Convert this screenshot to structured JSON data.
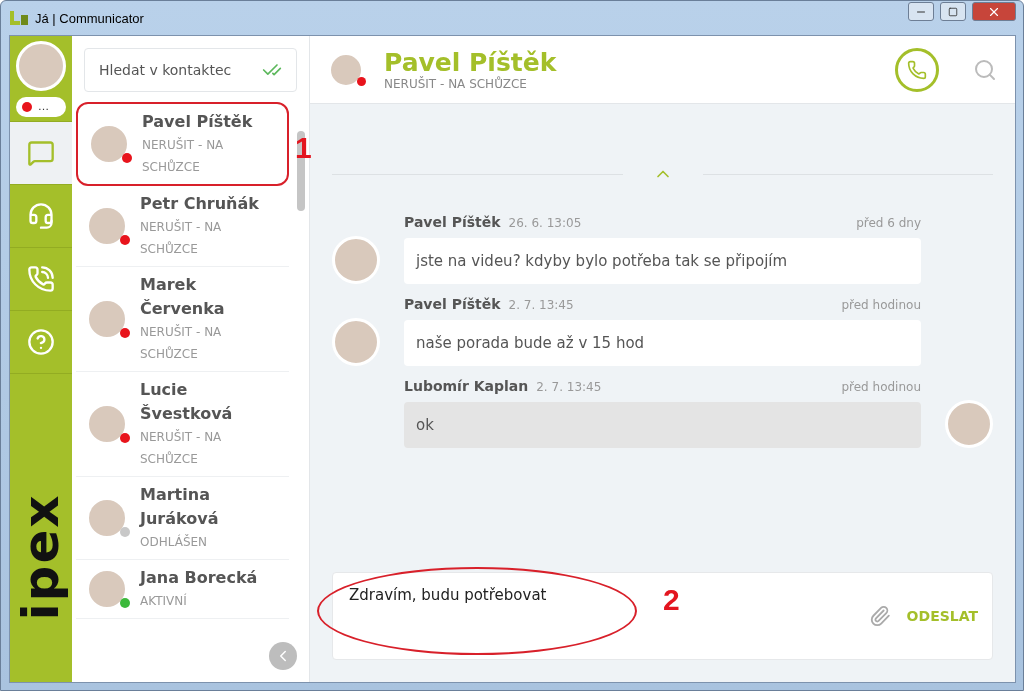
{
  "window": {
    "title": "Já | Communicator"
  },
  "me": {
    "busy": true,
    "status_text": "…"
  },
  "rail": [
    {
      "kind": "chat",
      "selected": true
    },
    {
      "kind": "headset",
      "selected": false
    },
    {
      "kind": "calls",
      "selected": false
    },
    {
      "kind": "help",
      "selected": false
    }
  ],
  "logo": "ipex",
  "search": {
    "placeholder": "Hledat v kontaktec"
  },
  "contacts": [
    {
      "name": "Pavel Píštěk",
      "status": "NERUŠIT - NA SCHŮZCE",
      "color": "#e8141c",
      "selected": true
    },
    {
      "name": "Petr Chruňák",
      "status": "NERUŠIT - NA SCHŮZCE",
      "color": "#e8141c",
      "selected": false
    },
    {
      "name": "Marek Červenka",
      "status": "NERUŠIT - NA SCHŮZCE",
      "color": "#e8141c",
      "selected": false
    },
    {
      "name": "Lucie Švestková",
      "status": "NERUŠIT - NA SCHŮZCE",
      "color": "#e8141c",
      "selected": false
    },
    {
      "name": "Martina Juráková",
      "status": "ODHLÁŠEN",
      "color": "#c8c8c8",
      "selected": false
    },
    {
      "name": "Jana Borecká",
      "status": "AKTIVNÍ",
      "color": "#3cb93c",
      "selected": false
    }
  ],
  "chat": {
    "name": "Pavel Píštěk",
    "status": "NERUŠIT - NA SCHŮZCE",
    "busy": true
  },
  "messages": [
    {
      "author": "Pavel Píštěk",
      "date": "26. 6. 13:05",
      "ago": "před 6 dny",
      "text": "jste na videu? kdyby bylo potřeba tak se připojím",
      "kind": "incoming"
    },
    {
      "author": "Pavel Píštěk",
      "date": "2. 7. 13:45",
      "ago": "před hodinou",
      "text": "naše porada bude až v 15 hod",
      "kind": "incoming"
    },
    {
      "author": "Lubomír Kaplan",
      "date": "2. 7. 13:45",
      "ago": "před hodinou",
      "text": "ok",
      "kind": "outgoing"
    }
  ],
  "composer": {
    "value": "Zdravím, budu potřebovat",
    "send": "ODESLAT"
  },
  "annotations": [
    "1",
    "2"
  ]
}
